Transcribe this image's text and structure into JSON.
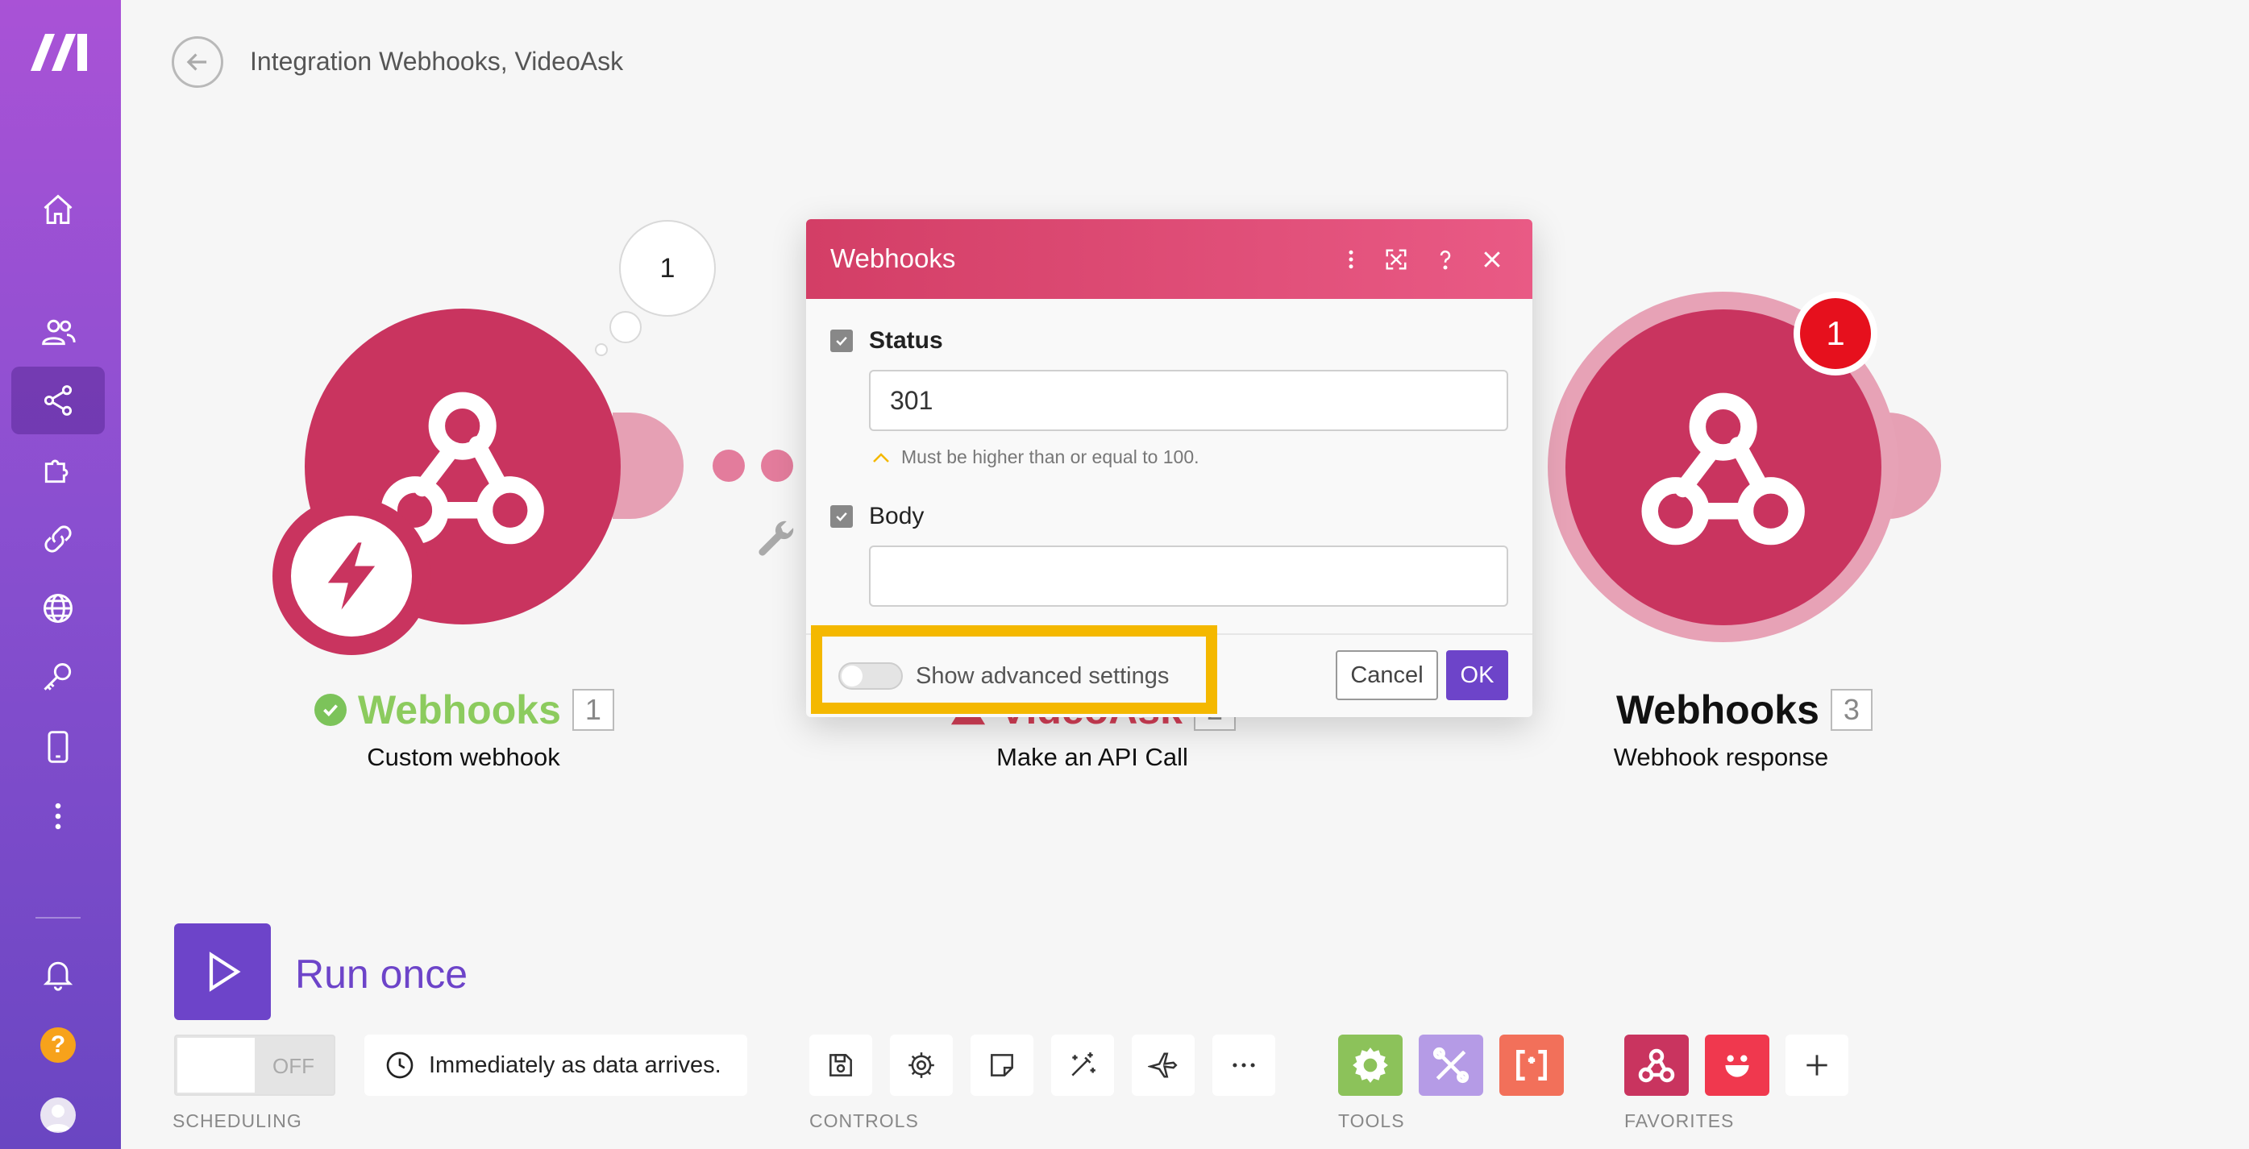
{
  "header": {
    "title": "Integration Webhooks, VideoAsk"
  },
  "modules": [
    {
      "title": "Webhooks",
      "id": "1",
      "subtitle": "Custom webhook",
      "status": "ok",
      "bubble_count": "1"
    },
    {
      "title": "VideoAsk",
      "id": "2",
      "subtitle": "Make an API Call",
      "status": "warning"
    },
    {
      "title": "Webhooks",
      "id": "3",
      "subtitle": "Webhook response",
      "error_count": "1"
    }
  ],
  "dialog": {
    "title": "Webhooks",
    "status_label": "Status",
    "status_value": "301",
    "status_hint": "Must be higher than or equal to 100.",
    "body_label": "Body",
    "body_value": "",
    "advanced_label": "Show advanced settings",
    "cancel_label": "Cancel",
    "ok_label": "OK"
  },
  "toolbar": {
    "run_label": "Run once",
    "scheduling_state": "OFF",
    "scheduling_text": "Immediately as data arrives.",
    "scheduling_section": "SCHEDULING",
    "controls_section": "CONTROLS",
    "tools_section": "TOOLS",
    "favorites_section": "FAVORITES"
  },
  "colors": {
    "sidebar_top": "#a952d6",
    "sidebar_bottom": "#6a46c2",
    "module": "#c9345f",
    "accent": "#6d44c9",
    "highlight": "#f4b800",
    "error": "#e6101d",
    "success": "#7cc35a"
  }
}
